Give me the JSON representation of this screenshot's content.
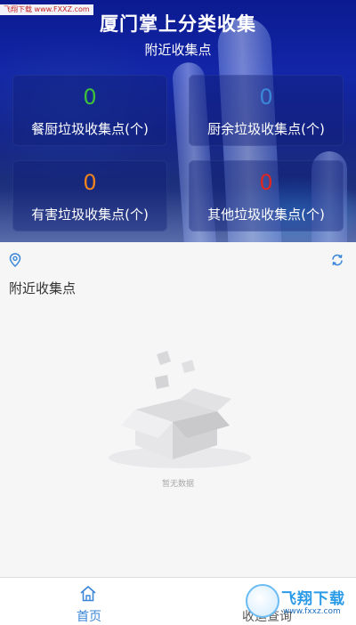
{
  "watermark": {
    "text": "飞翔下载 www.FXXZ.com"
  },
  "header": {
    "title": "厦门掌上分类收集",
    "subtitle": "附近收集点"
  },
  "stats": [
    {
      "value": "0",
      "label": "餐厨垃圾收集点(个)",
      "color": "#3ec23a"
    },
    {
      "value": "0",
      "label": "厨余垃圾收集点(个)",
      "color": "#3a86d8"
    },
    {
      "value": "0",
      "label": "有害垃圾收集点(个)",
      "color": "#f0831e"
    },
    {
      "value": "0",
      "label": "其他垃圾收集点(个)",
      "color": "#e0261f"
    }
  ],
  "nearby": {
    "section_title": "附近收集点",
    "empty_text": "暂无数据"
  },
  "tabs": [
    {
      "label": "首页",
      "icon": "home-icon",
      "active": true
    },
    {
      "label": "收运查询",
      "icon": "query-icon",
      "active": false
    }
  ],
  "corner_logo": {
    "brand": "飞翔下载",
    "site": "www.fxxz.com"
  },
  "colors": {
    "accent": "#3a86d8",
    "header_bg": "#1326a8"
  }
}
